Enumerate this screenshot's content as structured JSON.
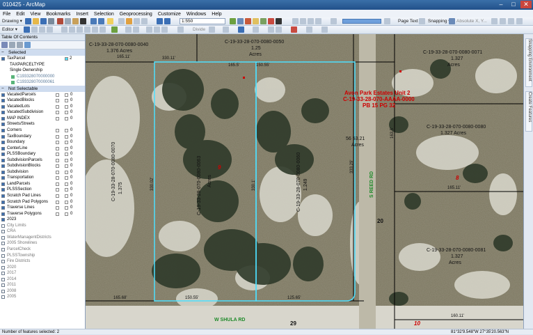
{
  "window": {
    "title": "010425 - ArcMap",
    "min": "–",
    "max": "□",
    "close": "✕"
  },
  "menu": [
    "File",
    "Edit",
    "View",
    "Bookmarks",
    "Insert",
    "Selection",
    "Geoprocessing",
    "Customize",
    "Windows",
    "Help"
  ],
  "toolbar": {
    "drawing": "Drawing ▾",
    "editor": "Editor ▾",
    "scale": "1:550",
    "page_text": "Page Text ▾",
    "snapping": "Snapping ▾",
    "absolute": "Absolute X, Y...",
    "divide": "Divide"
  },
  "toc": {
    "title": "Table Of Contents",
    "selected_header": "Selected",
    "selected_layer": "TaxParcel",
    "selected_count": "2",
    "field": "TAXPARCELTYPE",
    "ownership": "Single Ownership",
    "parcel_ids": [
      "C193328070000000",
      "C193328070000061"
    ],
    "not_selectable_header": "Not Selectable",
    "layers": [
      {
        "name": "VacatedParcels",
        "count": "0",
        "on": true
      },
      {
        "name": "VacatedBlocks",
        "count": "0",
        "on": true
      },
      {
        "name": "VacatedLots",
        "count": "0",
        "on": true
      },
      {
        "name": "VacatedSubdivision",
        "count": "0",
        "on": true
      },
      {
        "name": "MAP INDEX",
        "count": "0",
        "on": true
      },
      {
        "name": "Streets/Streets",
        "count": "",
        "on": true
      },
      {
        "name": "Corners",
        "count": "0",
        "on": true
      },
      {
        "name": "TaxBoundary",
        "count": "0",
        "on": true
      },
      {
        "name": "Boundary",
        "count": "0",
        "on": true
      },
      {
        "name": "CenterLine",
        "count": "0",
        "on": true
      },
      {
        "name": "PLSSBoundary",
        "count": "0",
        "on": true
      },
      {
        "name": "SubdivisionParcels",
        "count": "0",
        "on": true
      },
      {
        "name": "SubdivisionBlocks",
        "count": "0",
        "on": true
      },
      {
        "name": "Subdivision",
        "count": "0",
        "on": true
      },
      {
        "name": "Transportation",
        "count": "0",
        "on": true
      },
      {
        "name": "LandParcels",
        "count": "0",
        "on": true
      },
      {
        "name": "PLSSSection",
        "count": "0",
        "on": true
      },
      {
        "name": "Scratch Pad Lines",
        "count": "0",
        "on": true
      },
      {
        "name": "Scratch Pad Polygons",
        "count": "0",
        "on": true
      },
      {
        "name": "Traverse Lines",
        "count": "0",
        "on": true
      },
      {
        "name": "Traverse Polygons",
        "count": "0",
        "on": true
      },
      {
        "name": "2023",
        "count": "",
        "on": true
      },
      {
        "name": "City Limits",
        "count": "",
        "on": false
      },
      {
        "name": "CRA",
        "count": "",
        "on": false
      },
      {
        "name": "WaterManagentDistricts",
        "count": "",
        "on": false
      },
      {
        "name": "2005 Shorelines",
        "count": "",
        "on": false
      },
      {
        "name": "ParcelCheck",
        "count": "",
        "on": false
      },
      {
        "name": "PLSSTownship",
        "count": "",
        "on": false
      },
      {
        "name": "Fire Districts",
        "count": "",
        "on": false
      },
      {
        "name": "2020",
        "count": "",
        "on": false
      },
      {
        "name": "2017",
        "count": "",
        "on": false
      },
      {
        "name": "2014",
        "count": "",
        "on": false
      },
      {
        "name": "2011",
        "count": "",
        "on": false
      },
      {
        "name": "2008",
        "count": "",
        "on": false
      },
      {
        "name": "2005",
        "count": "",
        "on": false
      }
    ]
  },
  "map": {
    "labels": {
      "p_top_left": "C-19-33-28-070-0080-0040",
      "p_top_left_ac": "1.376 Acres",
      "p_top_mid": "C-19-33-28-070-0080-0050",
      "p_top_mid_ac": "1.25",
      "p_top_mid_ac2": "Acres",
      "p_top_right": "C-19-33-28-070-0080-0071",
      "p_top_right_ac": "1.327",
      "p_top_right_ac2": "Acres",
      "p_mid_right": "C-19-33-28-070-0080-0080",
      "p_mid_right_ac": "1.327 Acres",
      "p_lower_right": "C-19-33-28-070-0080-0081",
      "p_lower_right_ac": "1.327",
      "p_lower_right_ac2": "Acres",
      "p_left": "C-19-33-28-070-0080-0070",
      "p_left_ac": "1.375",
      "p_sel1": "C-19-33-28-070-0080-0063",
      "p_sel1_ac": "Acres",
      "p_sel2": "C-19-33-28-070-0080-0060",
      "p_sel2_ac": "1.249",
      "subdiv_1": "Avon Park Estates Unit 2",
      "subdiv_2": "C-19-33-28-070-AAAA-0000",
      "subdiv_3": "PB 15 PG 32",
      "area_val": "56 53.21",
      "area_unit": "Acres",
      "block_9": "9",
      "block_8": "8",
      "block_20": "20",
      "block_29": "29",
      "block_10": "10",
      "road_reed": "S REED RD",
      "road_shula": "W SHULA RD",
      "dim_top1": "165.11'",
      "dim_top2": "165.5'",
      "dim_top3": "150.55'",
      "dim_top4": "163.5'",
      "dim_bot1": "165.68'",
      "dim_bot2": "150.55'",
      "dim_bot3": "125.65'",
      "dim_right1": "165.11'",
      "dim_right2": "160.11'",
      "dim_side1": "330.11'",
      "dim_side2": "330.02'",
      "dim_side3": "330.1'",
      "dim_side4": "333.29'"
    }
  },
  "dock": {
    "tab1": "Snapping Environment",
    "tab2": "Create Features"
  },
  "status": {
    "left": "Number of features selected: 2",
    "right": "81°32'9.548\"W  27°35'20.563\"N"
  },
  "colors": {
    "selection": "#4de0ff",
    "subdiv_text": "#cc0000",
    "road_label": "#1f8a2a",
    "parcel_line": "#000000"
  }
}
